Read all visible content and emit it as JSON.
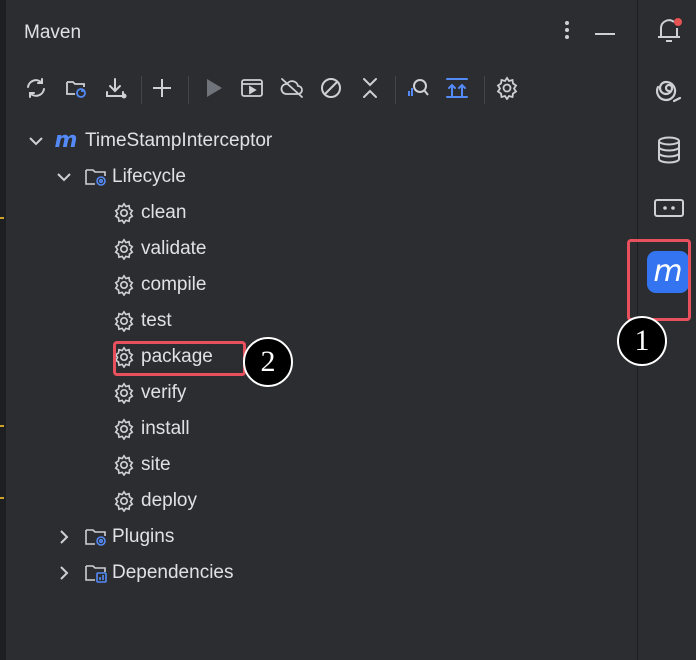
{
  "panel": {
    "title": "Maven",
    "more_icon": "more-vertical-icon",
    "hide_icon": "minimize-icon"
  },
  "toolbar": {
    "items": [
      {
        "name": "reload-all-projects-button",
        "icon": "refresh-icon"
      },
      {
        "name": "generate-sources-button",
        "icon": "folder-refresh-icon"
      },
      {
        "name": "download-sources-button",
        "icon": "download-icon"
      },
      {
        "name": "add-project-button",
        "icon": "plus-icon"
      },
      {
        "name": "run-maven-build-button",
        "icon": "play-icon"
      },
      {
        "name": "execute-goal-button",
        "icon": "run-config-icon"
      },
      {
        "name": "toggle-offline-mode-button",
        "icon": "cloud-off-icon"
      },
      {
        "name": "skip-tests-button",
        "icon": "no-entry-icon"
      },
      {
        "name": "collapse-all-button",
        "icon": "collapse-icon"
      },
      {
        "name": "analyze-dependencies-button",
        "icon": "analyze-icon"
      },
      {
        "name": "show-dependencies-button",
        "icon": "expand-all-icon"
      },
      {
        "name": "maven-settings-button",
        "icon": "gear-icon"
      }
    ]
  },
  "tree": {
    "project": "TimeStampInterceptor",
    "lifecycle": {
      "label": "Lifecycle",
      "goals": [
        "clean",
        "validate",
        "compile",
        "test",
        "package",
        "verify",
        "install",
        "site",
        "deploy"
      ]
    },
    "plugins": "Plugins",
    "dependencies": "Dependencies"
  },
  "right_toolbar": {
    "items": [
      "notifications-icon",
      "ai-assistant-icon",
      "database-icon",
      "terminal-icon",
      "maven-icon"
    ],
    "maven_glyph": "m"
  },
  "annotations": {
    "callout_1": "1",
    "callout_2": "2"
  },
  "colors": {
    "accent": "#3574f0",
    "highlight": "#e8505e",
    "background": "#2b2d30",
    "text": "#dfe1e5",
    "notification_dot": "#e55353"
  }
}
